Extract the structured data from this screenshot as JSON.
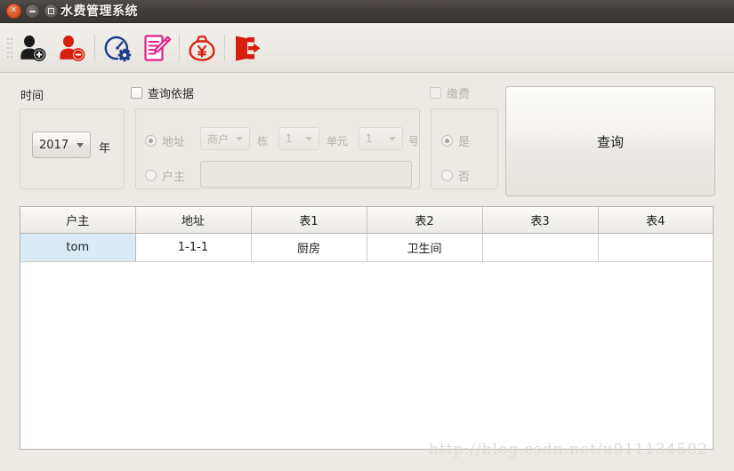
{
  "window": {
    "title": "水费管理系统",
    "controls": [
      {
        "name": "close",
        "glyph": "✕"
      },
      {
        "name": "minimize",
        "glyph": "−"
      },
      {
        "name": "maximize",
        "glyph": "□"
      }
    ]
  },
  "toolbar": {
    "buttons": [
      {
        "icon": "add-user-icon",
        "color": "#1a1a1a"
      },
      {
        "icon": "remove-user-icon",
        "color": "#d61f0f"
      },
      {
        "icon": "meter-settings-icon",
        "color": "#1f3c8c"
      },
      {
        "icon": "edit-record-icon",
        "color": "#e0218a"
      },
      {
        "icon": "money-bag-yuan-icon",
        "color": "#d61f0f"
      },
      {
        "icon": "exit-door-icon",
        "color": "#d61f0f"
      }
    ]
  },
  "filters": {
    "time_group": {
      "label": "时间",
      "year_value": "2017",
      "year_unit": "年"
    },
    "basis_group": {
      "checkbox_label": "查询依据",
      "checked": false,
      "address_radio": "地址",
      "address_selected": true,
      "owner_radio": "户主",
      "owner_selected": false,
      "type_value": "商户",
      "building_label": "栋",
      "building_value": "1",
      "unit_label": "单元",
      "unit_value": "1",
      "number_label": "号",
      "owner_input_value": "",
      "owner_input_placeholder": ""
    },
    "pay_group": {
      "checkbox_label": "缴费",
      "checked": false,
      "yes_label": "是",
      "yes_selected": true,
      "no_label": "否",
      "no_selected": false
    },
    "query_button_label": "查询"
  },
  "table": {
    "columns": [
      "户主",
      "地址",
      "表1",
      "表2",
      "表3",
      "表4"
    ],
    "rows": [
      [
        "tom",
        "1-1-1",
        "厨房",
        "卫生间",
        "",
        ""
      ]
    ],
    "selected_cell": {
      "row": 0,
      "col": 0
    }
  },
  "watermark": "http://blog.csdn.net/u011134502",
  "colors": {
    "window_bg": "#edeae5",
    "titlebar": "#413c39",
    "close_button": "#df5a22",
    "selection": "#dceaf5",
    "accent_red": "#d61f0f",
    "accent_blue": "#1f3c8c",
    "accent_pink": "#e0218a"
  }
}
